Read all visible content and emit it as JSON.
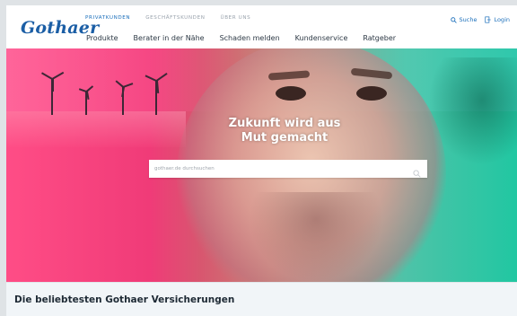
{
  "header": {
    "logo_text": "Gothaer",
    "top_nav": [
      {
        "label": "PRIVATKUNDEN",
        "active": true
      },
      {
        "label": "GESCHÄFTSKUNDEN",
        "active": false
      },
      {
        "label": "ÜBER UNS",
        "active": false
      }
    ],
    "main_nav": [
      "Produkte",
      "Berater in der Nähe",
      "Schaden melden",
      "Kundenservice",
      "Ratgeber"
    ],
    "utility": {
      "search_label": "Suche",
      "login_label": "Login"
    }
  },
  "hero": {
    "headline_line1": "Zukunft wird aus",
    "headline_line2": "Mut gemacht",
    "search_placeholder": "gothaer.de durchsuchen"
  },
  "section": {
    "title": "Die beliebtesten Gothaer Versicherungen"
  },
  "colors": {
    "brand_blue": "#1b5ea5",
    "nav_active": "#1b6fbb",
    "hero_pink": "#ff4d86",
    "hero_teal": "#21c7a2"
  }
}
